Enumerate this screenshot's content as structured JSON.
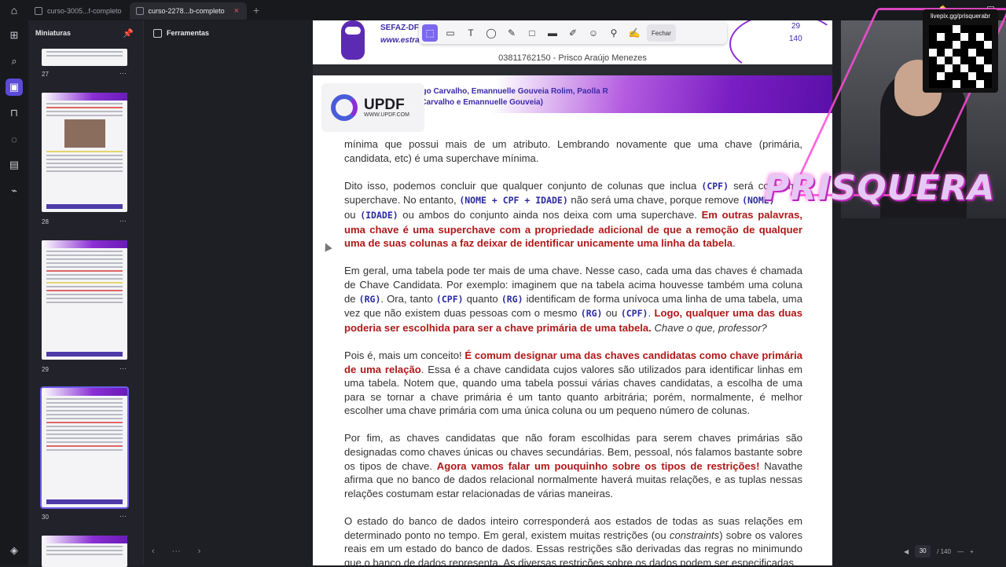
{
  "tabs": [
    {
      "label": "curso-3005...f-completo"
    },
    {
      "label": "curso-2278...b-completo"
    }
  ],
  "sidebar": {
    "title": "Miniaturas",
    "pages": [
      "27",
      "28",
      "29",
      "30"
    ]
  },
  "tools": {
    "title": "Ferramentas"
  },
  "toolbar": {
    "close_label": "Fechar"
  },
  "previous_page": {
    "brand1": "SEFAZ-DF",
    "brand2": "www.estrat",
    "num1": "29",
    "num2": "140",
    "footer": "03811762150 - Prisco Araújo Menezes"
  },
  "header_band": {
    "line1": "André Castro, Diego Carvalho, Emannuelle Gouveia Rolim, Paolla R",
    "line2": "iego Carvalho e Emannuelle Gouveia)"
  },
  "updf_badge": {
    "name": "UPDF",
    "url": "WWW.UPDF.COM"
  },
  "content": {
    "p1": "mínima que possui mais de um atributo. Lembrando novamente que uma chave (primária, candidata, etc) é uma superchave mínima.",
    "p2a": "Dito isso, podemos concluir que qualquer conjunto de colunas que inclua ",
    "c_cpf": "(CPF)",
    "p2b": " será com uma superchave. No entanto, ",
    "c_nome_cpf_idade": "(NOME + CPF + IDADE)",
    "p2c": " não será uma chave, porque remove ",
    "c_nome": "(NOME)",
    "p2d": " ou ",
    "c_idade": "(IDADE)",
    "p2e": " ou ambos do conjunto ainda nos deixa com uma superchave. ",
    "p2red": "Em outras palavras, uma chave é uma superchave com a propriedade adicional de que a remoção de qualquer uma de suas colunas a faz deixar de identificar unicamente uma linha da tabela",
    "p2f": ".",
    "p3a": "Em geral, uma tabela pode ter mais de uma chave. Nesse caso, cada uma das chaves é chamada de Chave Candidata. Por exemplo: imaginem que na tabela acima houvesse também uma coluna de ",
    "c_rg": "(RG)",
    "p3b": ". Ora, tanto ",
    "p3c": " quanto ",
    "p3d": " identificam de forma unívoca uma linha de uma tabela, uma vez que não existem duas pessoas com o mesmo ",
    "p3e": " ou ",
    "p3f": ". ",
    "p3red": "Logo, qualquer uma das duas poderia ser escolhida para ser a chave primária de uma tabela.",
    "p3it": " Chave o que, professor?",
    "p4a": "Pois é, mais um conceito! ",
    "p4red": "É comum designar uma das chaves candidatas como chave primária de uma relação",
    "p4b": ". Essa é a chave candidata cujos valores são utilizados para identificar linhas em uma tabela. Notem que, quando uma tabela possui várias chaves candidatas, a escolha de uma para se tornar a chave primária é um tanto quanto arbitrária; porém, normalmente, é melhor escolher uma chave primária com uma única coluna ou um pequeno número de colunas.",
    "p5a": "Por fim, as chaves candidatas que não foram escolhidas para serem chaves primárias são designadas como chaves únicas ou chaves secundárias. Bem, pessoal, nós falamos bastante sobre os tipos de chave. ",
    "p5red": "Agora vamos falar um pouquinho sobre os tipos de restrições!",
    "p5b": " Navathe afirma que no banco de dados relacional normalmente haverá muitas relações, e as tuplas nessas relações costumam estar relacionadas de várias maneiras.",
    "p6a": "O estado do banco de dados inteiro corresponderá aos estados de todas as suas relações em determinado ponto no tempo. Em geral, existem muitas restrições (ou ",
    "p6it": "constraints",
    "p6b": ") sobre os valores reais em um estado do banco de dados. Essas restrições são derivadas das regras no minimundo que o banco de dados representa. As diversas restrições sobre os dados podem ser especificadas"
  },
  "overlay": {
    "brand": "PRISQUERA",
    "qr_label": "livepix.gg/prisquerabr"
  },
  "pager": {
    "current": "30",
    "total": "/ 140"
  },
  "icons": {
    "home": "home-icon",
    "pin": "pin-icon",
    "tools": "toolbox-icon"
  },
  "colors": {
    "accent": "#7b68ee",
    "emphasis": "#b01818",
    "code": "#2a2aa0",
    "brand_purple": "#8a2fd4"
  }
}
